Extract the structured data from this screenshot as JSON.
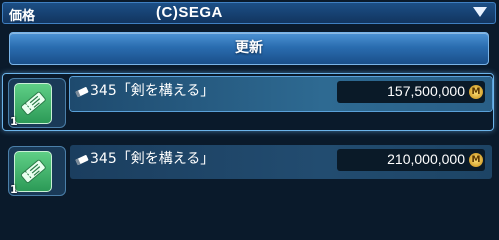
{
  "sort_bar": {
    "label": "価格",
    "copyright": "(C)SEGA"
  },
  "refresh_label": "更新",
  "items": [
    {
      "name": "345「剣を構える」",
      "price": "157,500,000",
      "quantity": "1",
      "currency_mark": "M",
      "selected": true
    },
    {
      "name": "345「剣を構える」",
      "price": "210,000,000",
      "quantity": "1",
      "currency_mark": "M",
      "selected": false
    }
  ],
  "colors": {
    "accent": "#2a6db0",
    "item_tile": "#3fb56c",
    "currency": "#e0a93a"
  }
}
